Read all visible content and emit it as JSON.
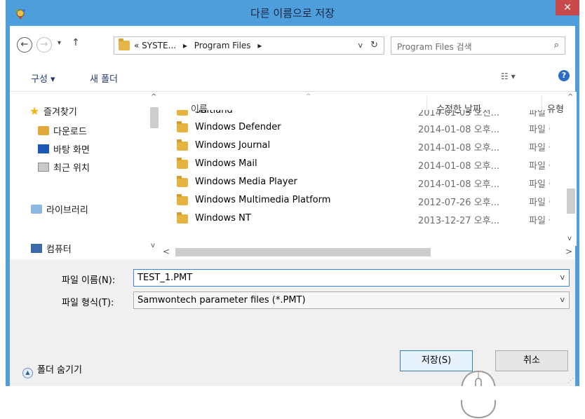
{
  "window": {
    "title": "다른 이름으로 저장",
    "close_glyph": "✕",
    "accent_color": "#4f9edc"
  },
  "address_bar": {
    "back_glyph": "←",
    "forward_glyph": "→",
    "recent_glyph": "▾",
    "up_glyph": "↑",
    "crumbs": [
      "« SYSTE...",
      "▸",
      "Program Files",
      "▸"
    ],
    "dropdown_glyph": "v",
    "refresh_glyph": "↻"
  },
  "search": {
    "placeholder": "Program Files 검색",
    "icon_glyph": "⌕"
  },
  "toolbar": {
    "organize_label": "구성 ▾",
    "new_folder_label": "새 폴더",
    "view_glyph": "☷ ▾",
    "help_glyph": "?"
  },
  "nav_pane": {
    "favorites_label": "즐겨찾기",
    "items": [
      {
        "label": "다운로드",
        "icon": "downloads-icon"
      },
      {
        "label": "바탕 화면",
        "icon": "desktop-icon"
      },
      {
        "label": "최근 위치",
        "icon": "recent-places-icon"
      }
    ],
    "libraries_label": "라이브러리",
    "computer_label": "컴퓨터",
    "scroll_up": "^",
    "scroll_down": "v"
  },
  "file_list": {
    "columns": {
      "name": "이름",
      "date": "수정한 날짜",
      "type": "유형"
    },
    "sort_caret": "^",
    "rows": [
      {
        "name": "Softland",
        "date": "2014-01-03 오전...",
        "type": "파일 폴더"
      },
      {
        "name": "Windows Defender",
        "date": "2014-01-08 오후...",
        "type": "파일 폴더"
      },
      {
        "name": "Windows Journal",
        "date": "2014-01-08 오후...",
        "type": "파일 폴더"
      },
      {
        "name": "Windows Mail",
        "date": "2014-01-08 오후...",
        "type": "파일 폴더"
      },
      {
        "name": "Windows Media Player",
        "date": "2014-01-08 오후...",
        "type": "파일 폴더"
      },
      {
        "name": "Windows Multimedia Platform",
        "date": "2012-07-26 오후...",
        "type": "파일 폴더"
      },
      {
        "name": "Windows NT",
        "date": "2013-12-27 오후...",
        "type": "파일 폴더"
      }
    ],
    "scroll_up": "^",
    "scroll_down": "v",
    "scroll_left": "<",
    "scroll_right": ">"
  },
  "fields": {
    "filename_label": "파일 이름(N):",
    "filename_value": "TEST_1.PMT",
    "filetype_label": "파일 형식(T):",
    "filetype_value": "Samwontech parameter files (*.PMT)",
    "dropdown_glyph": "v"
  },
  "footer": {
    "hide_folders_label": "폴더 숨기기",
    "hide_folders_glyph": "▲",
    "save_label": "저장(S)",
    "cancel_label": "취소",
    "grip_glyph": "⋰"
  }
}
